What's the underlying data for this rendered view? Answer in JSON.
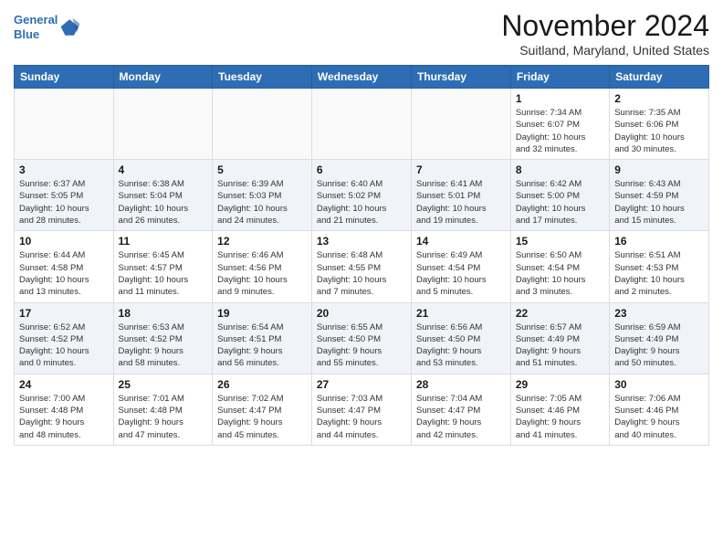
{
  "logo": {
    "line1": "General",
    "line2": "Blue"
  },
  "title": "November 2024",
  "location": "Suitland, Maryland, United States",
  "days_header": [
    "Sunday",
    "Monday",
    "Tuesday",
    "Wednesday",
    "Thursday",
    "Friday",
    "Saturday"
  ],
  "weeks": [
    [
      {
        "day": "",
        "info": ""
      },
      {
        "day": "",
        "info": ""
      },
      {
        "day": "",
        "info": ""
      },
      {
        "day": "",
        "info": ""
      },
      {
        "day": "",
        "info": ""
      },
      {
        "day": "1",
        "info": "Sunrise: 7:34 AM\nSunset: 6:07 PM\nDaylight: 10 hours\nand 32 minutes."
      },
      {
        "day": "2",
        "info": "Sunrise: 7:35 AM\nSunset: 6:06 PM\nDaylight: 10 hours\nand 30 minutes."
      }
    ],
    [
      {
        "day": "3",
        "info": "Sunrise: 6:37 AM\nSunset: 5:05 PM\nDaylight: 10 hours\nand 28 minutes."
      },
      {
        "day": "4",
        "info": "Sunrise: 6:38 AM\nSunset: 5:04 PM\nDaylight: 10 hours\nand 26 minutes."
      },
      {
        "day": "5",
        "info": "Sunrise: 6:39 AM\nSunset: 5:03 PM\nDaylight: 10 hours\nand 24 minutes."
      },
      {
        "day": "6",
        "info": "Sunrise: 6:40 AM\nSunset: 5:02 PM\nDaylight: 10 hours\nand 21 minutes."
      },
      {
        "day": "7",
        "info": "Sunrise: 6:41 AM\nSunset: 5:01 PM\nDaylight: 10 hours\nand 19 minutes."
      },
      {
        "day": "8",
        "info": "Sunrise: 6:42 AM\nSunset: 5:00 PM\nDaylight: 10 hours\nand 17 minutes."
      },
      {
        "day": "9",
        "info": "Sunrise: 6:43 AM\nSunset: 4:59 PM\nDaylight: 10 hours\nand 15 minutes."
      }
    ],
    [
      {
        "day": "10",
        "info": "Sunrise: 6:44 AM\nSunset: 4:58 PM\nDaylight: 10 hours\nand 13 minutes."
      },
      {
        "day": "11",
        "info": "Sunrise: 6:45 AM\nSunset: 4:57 PM\nDaylight: 10 hours\nand 11 minutes."
      },
      {
        "day": "12",
        "info": "Sunrise: 6:46 AM\nSunset: 4:56 PM\nDaylight: 10 hours\nand 9 minutes."
      },
      {
        "day": "13",
        "info": "Sunrise: 6:48 AM\nSunset: 4:55 PM\nDaylight: 10 hours\nand 7 minutes."
      },
      {
        "day": "14",
        "info": "Sunrise: 6:49 AM\nSunset: 4:54 PM\nDaylight: 10 hours\nand 5 minutes."
      },
      {
        "day": "15",
        "info": "Sunrise: 6:50 AM\nSunset: 4:54 PM\nDaylight: 10 hours\nand 3 minutes."
      },
      {
        "day": "16",
        "info": "Sunrise: 6:51 AM\nSunset: 4:53 PM\nDaylight: 10 hours\nand 2 minutes."
      }
    ],
    [
      {
        "day": "17",
        "info": "Sunrise: 6:52 AM\nSunset: 4:52 PM\nDaylight: 10 hours\nand 0 minutes."
      },
      {
        "day": "18",
        "info": "Sunrise: 6:53 AM\nSunset: 4:52 PM\nDaylight: 9 hours\nand 58 minutes."
      },
      {
        "day": "19",
        "info": "Sunrise: 6:54 AM\nSunset: 4:51 PM\nDaylight: 9 hours\nand 56 minutes."
      },
      {
        "day": "20",
        "info": "Sunrise: 6:55 AM\nSunset: 4:50 PM\nDaylight: 9 hours\nand 55 minutes."
      },
      {
        "day": "21",
        "info": "Sunrise: 6:56 AM\nSunset: 4:50 PM\nDaylight: 9 hours\nand 53 minutes."
      },
      {
        "day": "22",
        "info": "Sunrise: 6:57 AM\nSunset: 4:49 PM\nDaylight: 9 hours\nand 51 minutes."
      },
      {
        "day": "23",
        "info": "Sunrise: 6:59 AM\nSunset: 4:49 PM\nDaylight: 9 hours\nand 50 minutes."
      }
    ],
    [
      {
        "day": "24",
        "info": "Sunrise: 7:00 AM\nSunset: 4:48 PM\nDaylight: 9 hours\nand 48 minutes."
      },
      {
        "day": "25",
        "info": "Sunrise: 7:01 AM\nSunset: 4:48 PM\nDaylight: 9 hours\nand 47 minutes."
      },
      {
        "day": "26",
        "info": "Sunrise: 7:02 AM\nSunset: 4:47 PM\nDaylight: 9 hours\nand 45 minutes."
      },
      {
        "day": "27",
        "info": "Sunrise: 7:03 AM\nSunset: 4:47 PM\nDaylight: 9 hours\nand 44 minutes."
      },
      {
        "day": "28",
        "info": "Sunrise: 7:04 AM\nSunset: 4:47 PM\nDaylight: 9 hours\nand 42 minutes."
      },
      {
        "day": "29",
        "info": "Sunrise: 7:05 AM\nSunset: 4:46 PM\nDaylight: 9 hours\nand 41 minutes."
      },
      {
        "day": "30",
        "info": "Sunrise: 7:06 AM\nSunset: 4:46 PM\nDaylight: 9 hours\nand 40 minutes."
      }
    ]
  ]
}
